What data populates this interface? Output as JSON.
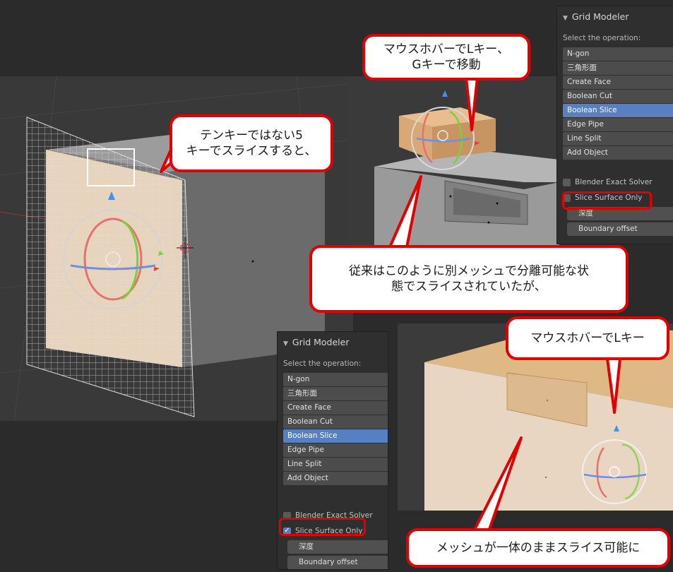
{
  "panel_top": {
    "title": "Grid Modeler",
    "subtitle": "Select the operation:",
    "operations": [
      "N-gon",
      "三角形面",
      "Create Face",
      "Boolean Cut",
      "Boolean Slice",
      "Edge Pipe",
      "Line Split",
      "Add Object"
    ],
    "selected": "Boolean Slice",
    "checkboxes": [
      {
        "label": "Blender Exact Solver",
        "checked": false
      },
      {
        "label": "Slice Surface Only",
        "checked": false
      }
    ],
    "fields": [
      "深度",
      "Boundary offset"
    ]
  },
  "panel_bottom": {
    "title": "Grid Modeler",
    "subtitle": "Select the operation:",
    "operations": [
      "N-gon",
      "三角形面",
      "Create Face",
      "Boolean Cut",
      "Boolean Slice",
      "Edge Pipe",
      "Line Split",
      "Add Object"
    ],
    "selected": "Boolean Slice",
    "checkboxes": [
      {
        "label": "Blender Exact Solver",
        "checked": false
      },
      {
        "label": "Slice Surface Only",
        "checked": true
      }
    ],
    "fields": [
      "深度",
      "Boundary offset"
    ]
  },
  "callouts": {
    "tenkey": [
      "テンキーではない5",
      "キーでスライスすると、"
    ],
    "hover_l_g": [
      "マウスホバーでLキー、",
      "Gキーで移動"
    ],
    "before": [
      "従来はこのように別メッシュで分離可能な状",
      "態でスライスされていたが、"
    ],
    "hover_l": [
      "マウスホバーでLキー"
    ],
    "after": [
      "メッシュが一体のままスライス可能に"
    ]
  },
  "colors": {
    "callout_red": "#e00000",
    "selected_blue": "#5680c2",
    "slice_plane": "#ead7c2",
    "cutter_block": "#d9a877"
  }
}
